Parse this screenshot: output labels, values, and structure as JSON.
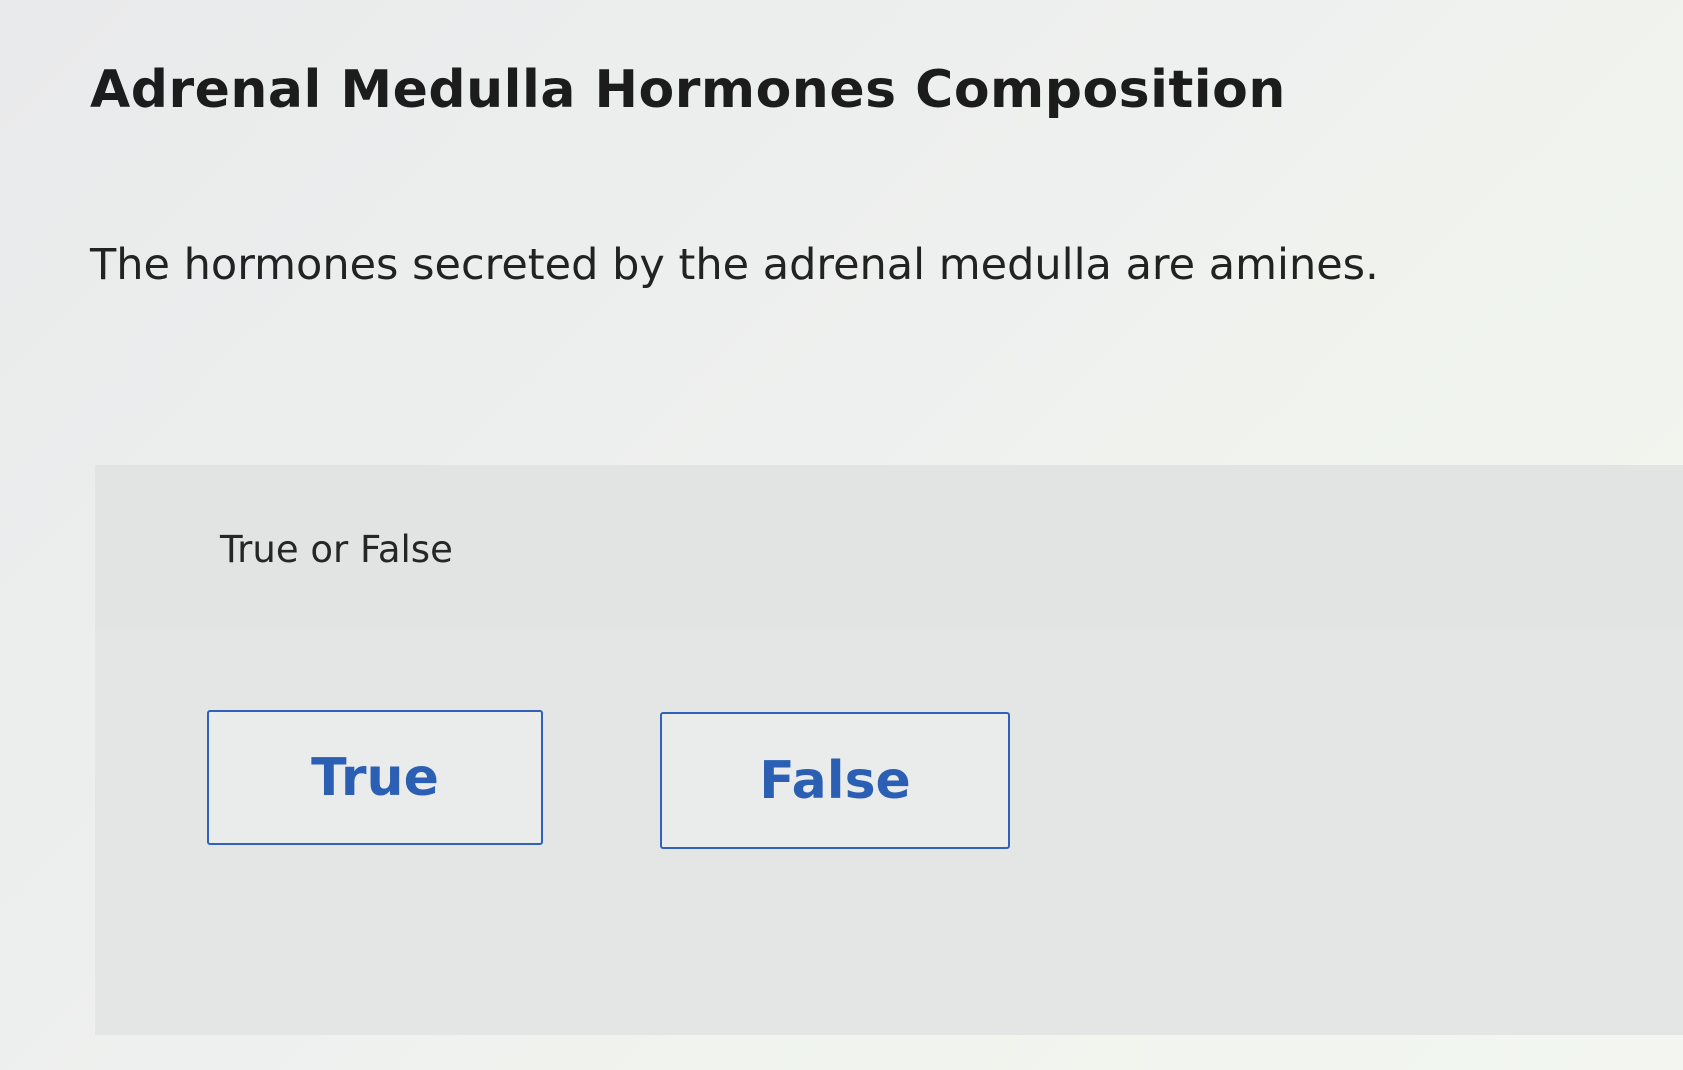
{
  "page": {
    "title": "Adrenal Medulla Hormones Composition",
    "question": "The hormones secreted by the adrenal medulla are amines."
  },
  "answer_panel": {
    "prompt": "True or False",
    "options": [
      {
        "label": "True"
      },
      {
        "label": "False"
      }
    ]
  },
  "colors": {
    "accent": "#2a5fb3",
    "panel_background": "#e4e5e5"
  }
}
